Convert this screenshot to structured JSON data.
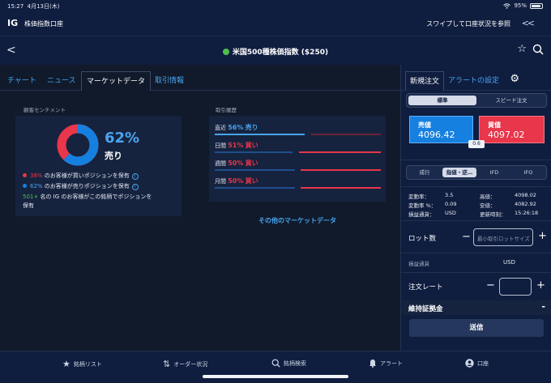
{
  "status_bar": {
    "time": "15:27",
    "date": "4月13日(木)",
    "battery": "95%"
  },
  "header": {
    "logo": "IG",
    "title": "株価指数口座",
    "swipe_hint": "スワイプして口座状況を参照",
    "collapse_icon": "double-chevron-left"
  },
  "instrument": {
    "name": "米国500種株価指数 ($250)",
    "status_color": "#4ec04a"
  },
  "tabs": [
    {
      "label": "チャート"
    },
    {
      "label": "ニュース"
    },
    {
      "label": "マーケットデータ"
    },
    {
      "label": "取引情報"
    }
  ],
  "sentiment": {
    "section_label": "顧客センチメント",
    "pct": "62%",
    "direction": "売り",
    "sell_fraction": 0.62,
    "buy_fraction": 0.38,
    "buy_row": {
      "pct": "38%",
      "text": " のお客様が買いポジションを保有"
    },
    "sell_row": {
      "pct": "62%",
      "text": " のお客様が売りポジションを保有"
    },
    "count_row": {
      "count": "501+",
      "text": " 名の IG のお客様がこの銘柄でポジションを",
      "text2": "保有"
    },
    "info_glyph": "i"
  },
  "history": {
    "section_label": "取引履歴",
    "rows": [
      {
        "period": "直近",
        "pct": "56%",
        "side": "売り",
        "fraction": 0.56,
        "side_type": "sell"
      },
      {
        "period": "日間",
        "pct": "51%",
        "side": "買い",
        "fraction": 0.51,
        "side_type": "buy"
      },
      {
        "period": "週間",
        "pct": "50%",
        "side": "買い",
        "fraction": 0.5,
        "side_type": "buy"
      },
      {
        "period": "月間",
        "pct": "50%",
        "side": "買い",
        "fraction": 0.5,
        "side_type": "buy"
      }
    ],
    "more_link": "その他のマーケットデータ"
  },
  "order_panel": {
    "tabs": {
      "new_order": "新規注文",
      "alert": "アラートの設定"
    },
    "mode": {
      "standard": "標準",
      "speed": "スピード注文"
    },
    "sell": {
      "label": "売値",
      "price": "4096.42"
    },
    "buy": {
      "label": "買値",
      "price": "4097.02"
    },
    "spread": "0.6",
    "order_types": {
      "market": "成行",
      "limit": "指値・逆…",
      "ifd": "IFD",
      "ifo": "IFO"
    },
    "stats": {
      "change_label": "変動率：",
      "change": "3.5",
      "change_pct_label": "変動率 %：",
      "change_pct": "0.09",
      "ccy_label": "損益通貨：",
      "ccy": "USD",
      "high_label": "高値：",
      "high": "4098.02",
      "low_label": "安値：",
      "low": "4082.92",
      "updated_label": "更新時刻：",
      "updated": "15:26:18"
    },
    "lot_label": "ロット数",
    "lot_placeholder": "最小取引ロットサイズ",
    "pl_ccy_label": "損益通貨",
    "pl_ccy": "USD",
    "rate_label": "注文レート",
    "minus": "−",
    "plus": "+",
    "margin_label": "維持証拠金",
    "margin_toggle": "-",
    "submit": "送信"
  },
  "bottom_nav": [
    {
      "label": "銘柄リスト",
      "icon": "star-icon"
    },
    {
      "label": "オーダー状況",
      "icon": "arrows-icon"
    },
    {
      "label": "銘柄検索",
      "icon": "search-icon"
    },
    {
      "label": "アラート",
      "icon": "bell-icon"
    },
    {
      "label": "口座",
      "icon": "person-icon"
    }
  ]
}
